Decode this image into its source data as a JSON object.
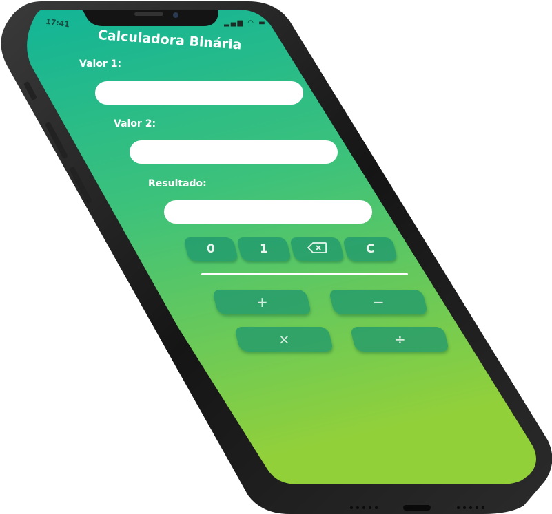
{
  "status_bar": {
    "time": "17:41",
    "icons": [
      "signal-icon",
      "wifi-icon",
      "battery-icon"
    ]
  },
  "app": {
    "title": "Calculadora Binária"
  },
  "fields": {
    "value1": {
      "label": "Valor 1:",
      "value": ""
    },
    "value2": {
      "label": "Valor 2:",
      "value": ""
    },
    "result": {
      "label": "Resultado:",
      "value": ""
    }
  },
  "keypad": {
    "zero": "0",
    "one": "1",
    "backspace_icon": "backspace-icon",
    "clear": "C"
  },
  "operations": {
    "add": "+",
    "subtract": "−",
    "multiply": "×",
    "divide": "÷"
  },
  "colors": {
    "gradient_top": "#14b394",
    "gradient_bottom": "#8fcf3a",
    "key_bg": "#1e966e",
    "phone_frame": "#1c1c1c"
  }
}
